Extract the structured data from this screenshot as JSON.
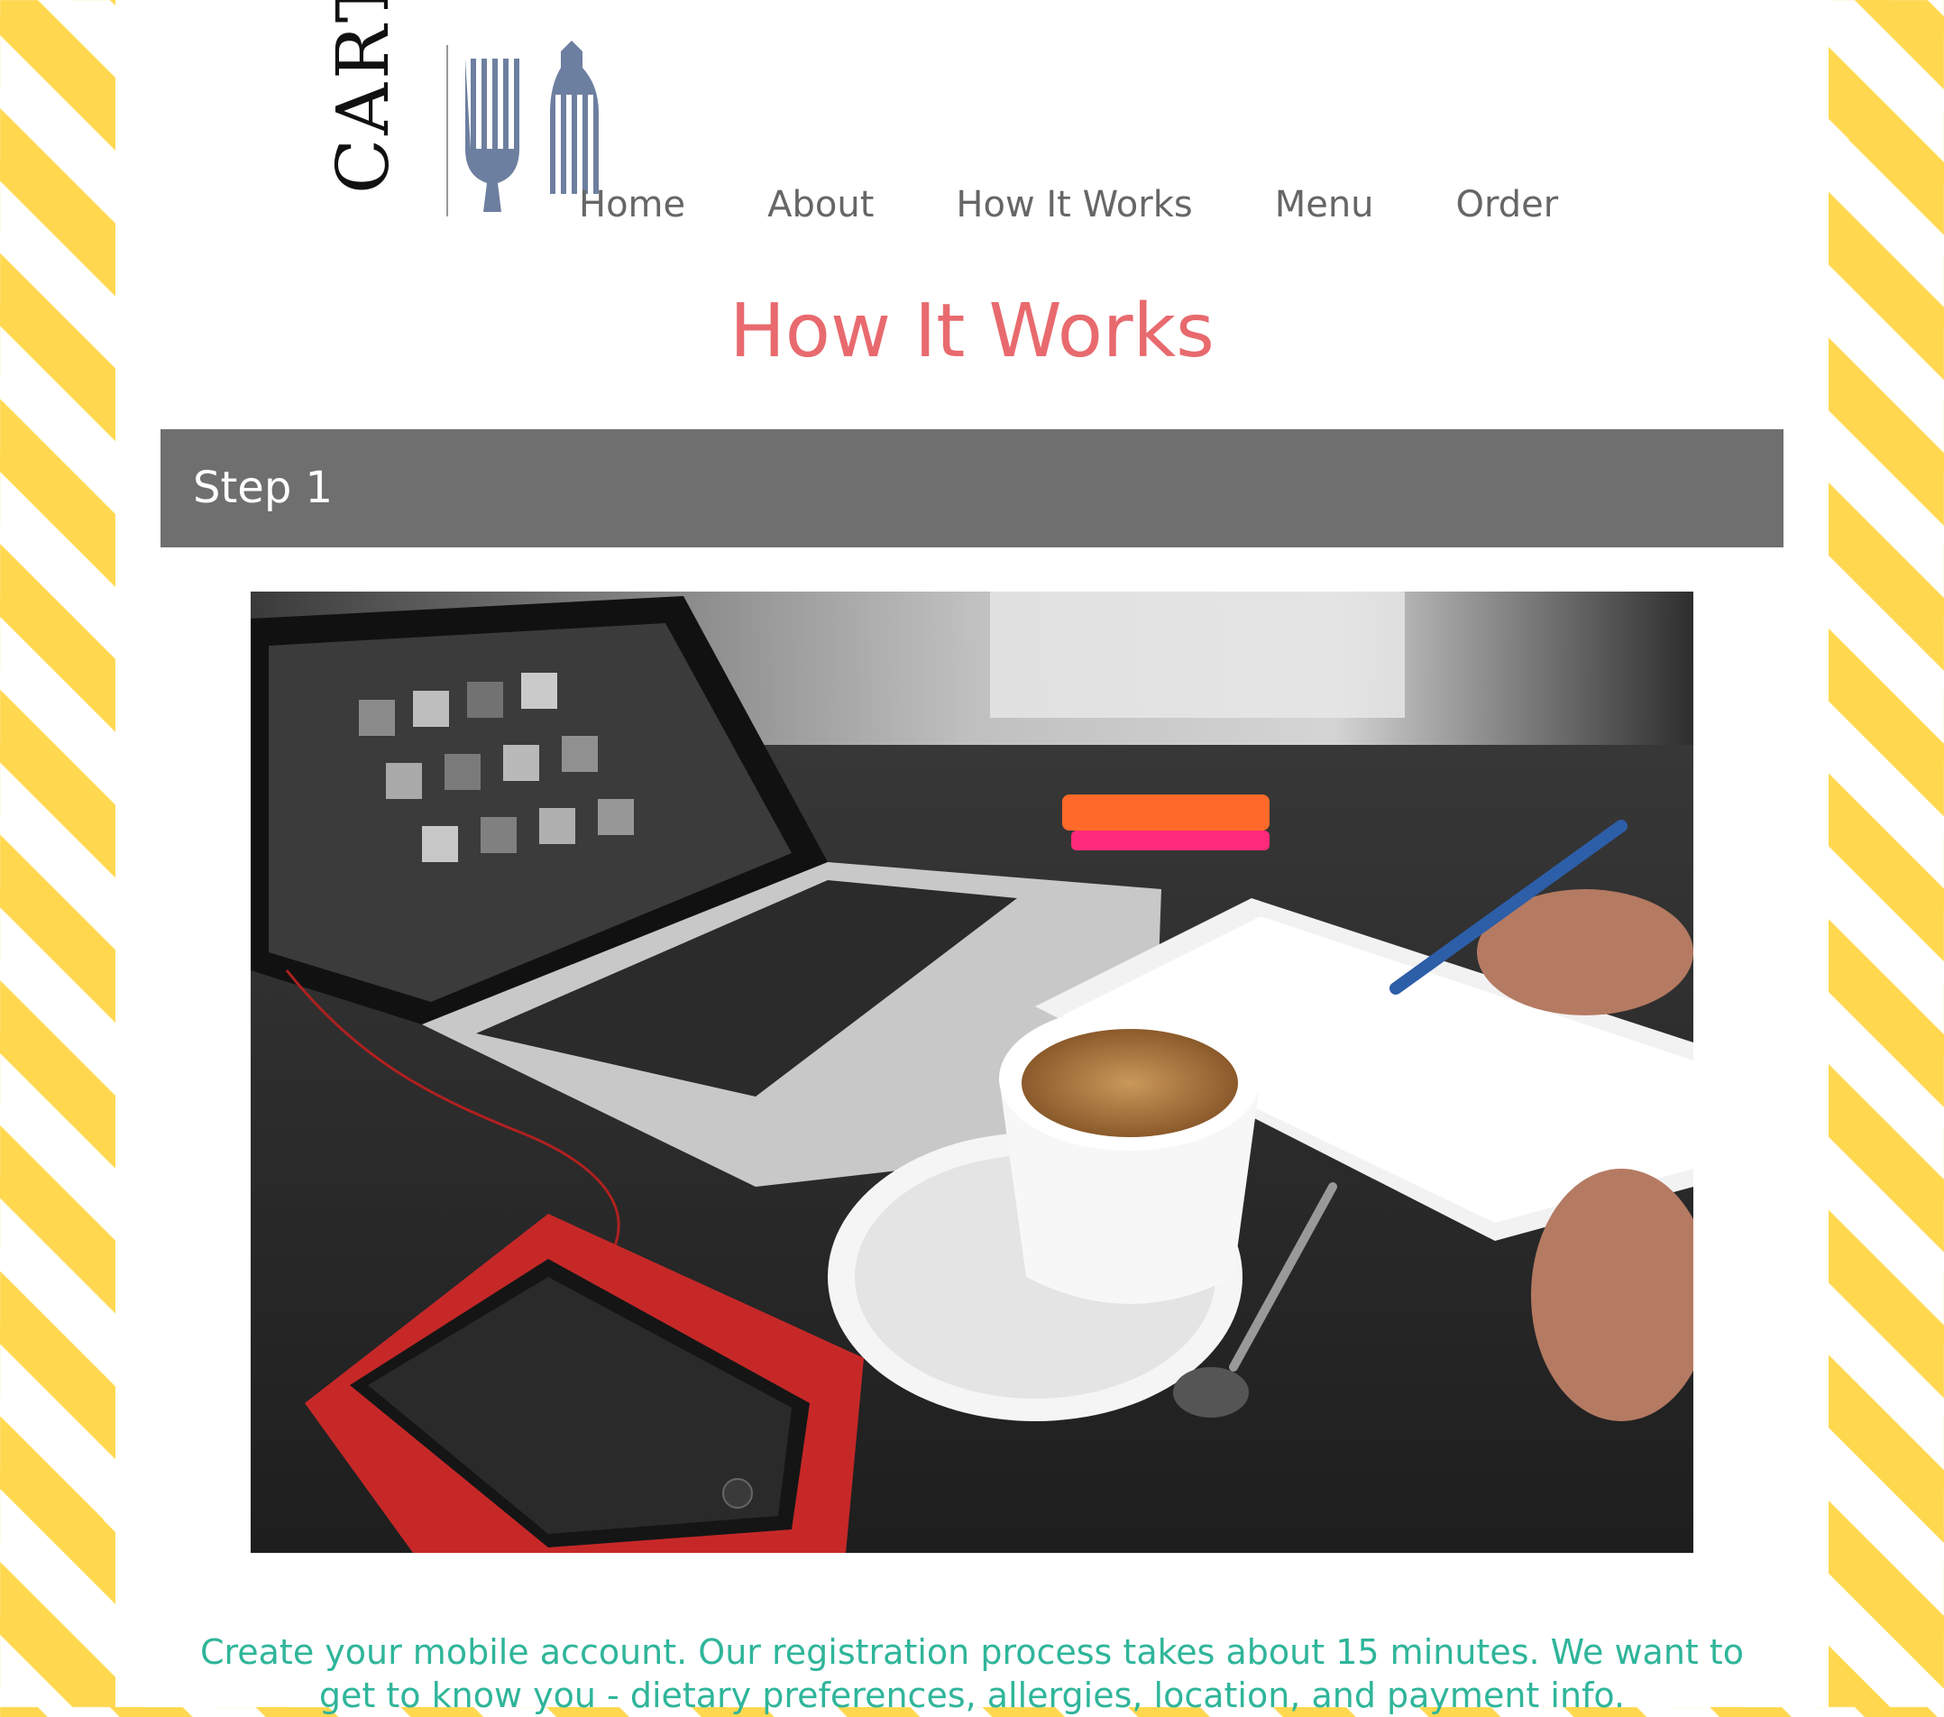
{
  "brand": {
    "logo_text": "CART"
  },
  "nav": {
    "items": [
      {
        "label": "Home"
      },
      {
        "label": "About"
      },
      {
        "label": "How It Works"
      },
      {
        "label": "Menu"
      },
      {
        "label": "Order"
      }
    ]
  },
  "main": {
    "title": "How It Works",
    "step": {
      "label": "Step 1",
      "description": "Create your mobile account. Our registration process takes about 15 minutes. We want to get to know you - dietary preferences, allergies, location, and payment info."
    }
  },
  "colors": {
    "stripe_yellow": "#ffd84f",
    "title_coral": "#e86a6e",
    "step_bar_gray": "#6f6f6f",
    "description_teal": "#2fb59a",
    "fork_blue": "#6d7fa0"
  }
}
